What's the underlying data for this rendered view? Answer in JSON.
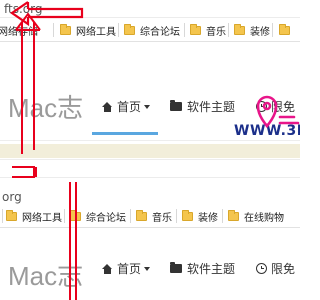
{
  "top": {
    "address": "fts.org",
    "bookmarks": [
      "网络存储",
      "网络工具",
      "综合论坛",
      "音乐",
      "装修"
    ],
    "nav": {
      "logo": "Mac志",
      "home": "首页",
      "topics": "软件主题",
      "limited": "限免"
    },
    "watermark": "WWW.3K"
  },
  "bottom": {
    "address": "org",
    "bookmarks": [
      "网络工具",
      "综合论坛",
      "音乐",
      "装修",
      "在线购物"
    ],
    "nav": {
      "logo": "Mac志",
      "home": "首页",
      "topics": "软件主题",
      "limited": "限免"
    }
  },
  "colors": {
    "annotation": "#e8001c",
    "watermark_pin": "#e8158a",
    "watermark_text": "#1b2f8a",
    "active_tab": "#5aa7e0",
    "folder": "#f4c54d"
  }
}
